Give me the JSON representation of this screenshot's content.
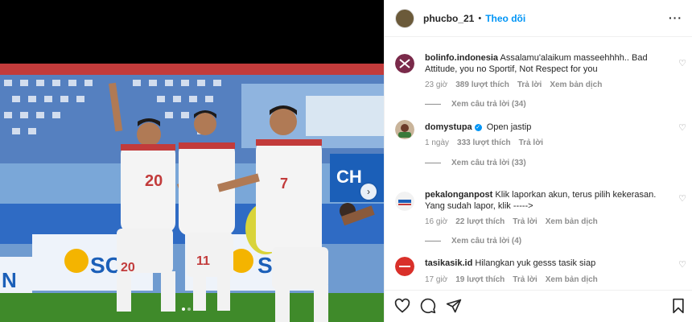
{
  "header": {
    "username": "phucbo_21",
    "separator": "•",
    "follow_label": "Theo dõi",
    "more_icon": "more-horizontal-icon"
  },
  "media": {
    "jersey_numbers": [
      "20",
      "11",
      "7",
      "20"
    ],
    "next_icon": "chevron-right-icon",
    "carousel_dots": 2,
    "active_dot": 0
  },
  "comments": [
    {
      "username": "bolinfo.indonesia",
      "text": "Assalamu'alaikum masseehhhh.. Bad Attitude, you no Sportif, Not Respect for you",
      "time": "23 giờ",
      "likes": "389 lượt thích",
      "reply": "Trả lời",
      "translate": "Xem bản dịch",
      "view_replies": "Xem câu trả lời (34)",
      "verified": false
    },
    {
      "username": "domystupa",
      "text": "Open jastip",
      "time": "1 ngày",
      "likes": "333 lượt thích",
      "reply": "Trả lời",
      "translate": "",
      "view_replies": "Xem câu trả lời (33)",
      "verified": true
    },
    {
      "username": "pekalonganpost",
      "text": "Klik laporkan akun, terus pilih kekerasan. Yang sudah lapor, klik ----->",
      "time": "16 giờ",
      "likes": "22 lượt thích",
      "reply": "Trả lời",
      "translate": "Xem bản dịch",
      "view_replies": "Xem câu trả lời (4)",
      "verified": false
    },
    {
      "username": "tasikasik.id",
      "text": "Hilangkan yuk gesss tasik siap",
      "time": "17 giờ",
      "likes": "19 lượt thích",
      "reply": "Trả lời",
      "translate": "Xem bản dịch",
      "view_replies": "",
      "verified": false
    }
  ],
  "actions": {
    "like_icon": "heart-icon",
    "comment_icon": "comment-icon",
    "share_icon": "send-icon",
    "save_icon": "bookmark-icon"
  },
  "colors": {
    "accent": "#0095f6",
    "muted": "#8e8e8e",
    "text": "#262626"
  }
}
